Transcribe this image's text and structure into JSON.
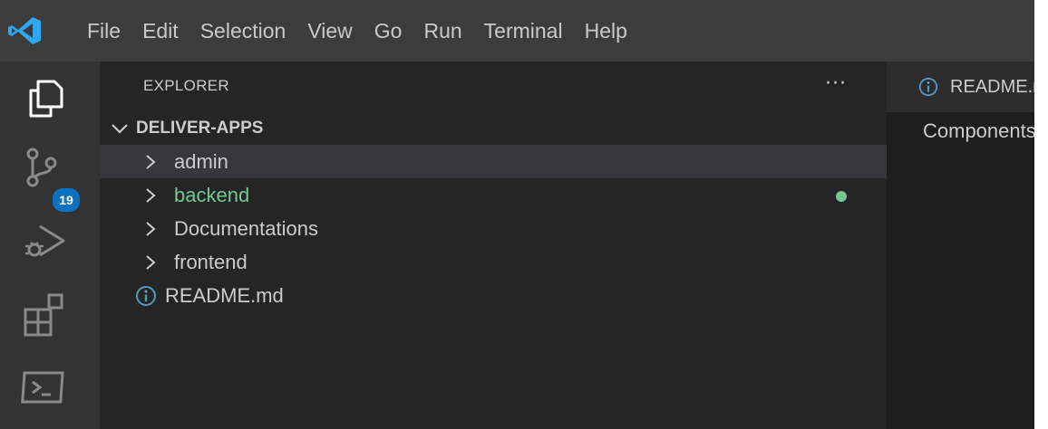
{
  "app": {
    "logo_icon": "vscode-logo-icon",
    "accent": "#0e70c0",
    "modified_color": "#73c991"
  },
  "menu": [
    "File",
    "Edit",
    "Selection",
    "View",
    "Go",
    "Run",
    "Terminal",
    "Help"
  ],
  "activity_bar": {
    "items": [
      {
        "icon": "explorer-icon"
      },
      {
        "icon": "source-control-icon",
        "badge": "19"
      },
      {
        "icon": "run-debug-icon"
      },
      {
        "icon": "extensions-icon"
      },
      {
        "icon": "terminal-icon"
      }
    ]
  },
  "sidebar": {
    "title": "EXPLORER",
    "more_label": "···",
    "root_folder": "DELIVER-APPS",
    "items": [
      {
        "label": "admin",
        "type": "folder",
        "selected": true
      },
      {
        "label": "backend",
        "type": "folder",
        "modified": true
      },
      {
        "label": "Documentations",
        "type": "folder"
      },
      {
        "label": "frontend",
        "type": "folder"
      },
      {
        "label": "README.md",
        "type": "file",
        "icon": "info-icon"
      }
    ]
  },
  "editor": {
    "tab_label": "README.md",
    "tab_icon": "info-icon",
    "visible_text": "Components"
  }
}
